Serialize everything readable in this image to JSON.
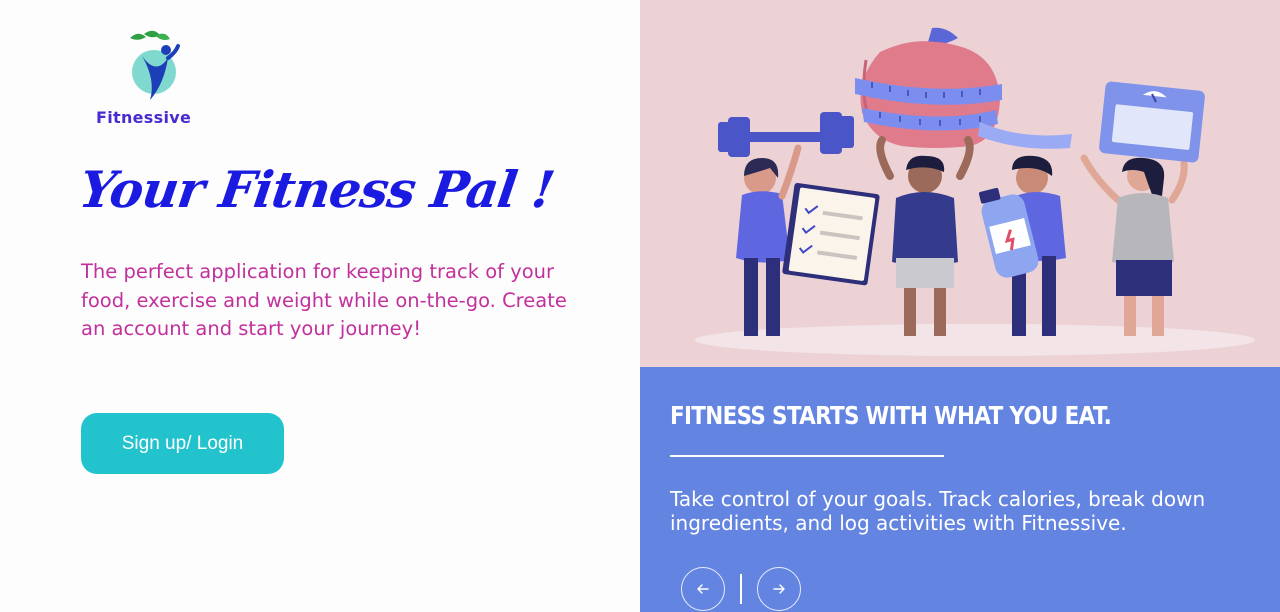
{
  "brand": {
    "name": "Fitnessive"
  },
  "hero": {
    "headline": "Your Fitness Pal !",
    "description": "The perfect application for keeping track of your food, exercise and weight while on-the-go. Create an account and start your journey!",
    "cta_label": "Sign up/ Login"
  },
  "panel": {
    "title": "FITNESS STARTS WITH WHAT YOU EAT.",
    "text": "Take control of your goals. Track calories, break down ingredients, and log activities with Fitnessive."
  },
  "icons": {
    "prev": "arrow-left-icon",
    "next": "arrow-right-icon",
    "logo": "runner-leaf-logo"
  },
  "colors": {
    "accent": "#22c3cc",
    "headline": "#1a1ae0",
    "description": "#c2309c",
    "panel": "#6384e0",
    "hero_bg": "#ecd2d5",
    "brand": "#4a2bd0"
  }
}
